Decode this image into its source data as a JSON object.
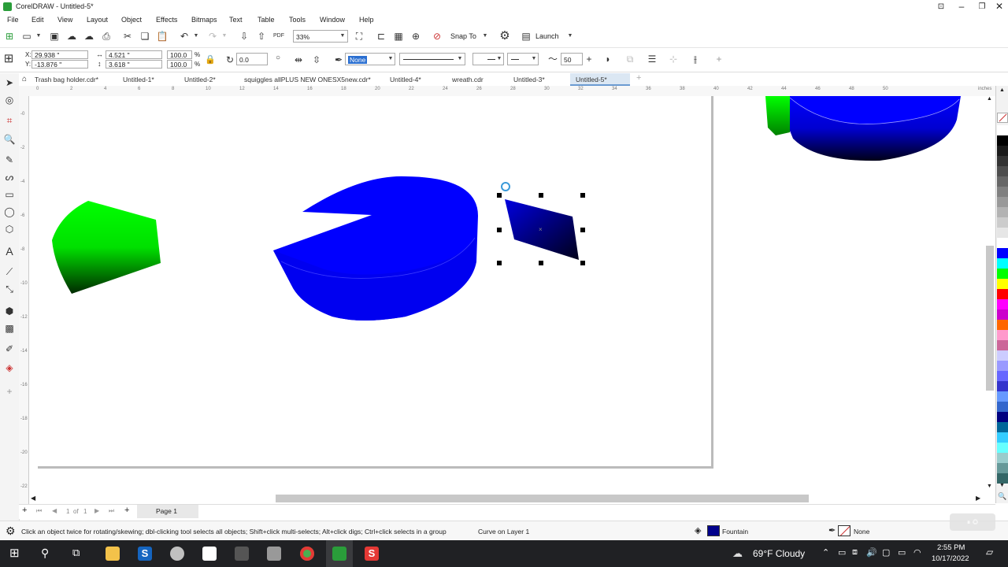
{
  "app": {
    "title": "CorelDRAW - Untitled-5*"
  },
  "menu": [
    "File",
    "Edit",
    "View",
    "Layout",
    "Object",
    "Effects",
    "Bitmaps",
    "Text",
    "Table",
    "Tools",
    "Window",
    "Help"
  ],
  "toolbar": {
    "zoom": "33%",
    "snap_to": "Snap To",
    "launch": "Launch"
  },
  "properties": {
    "x": "29.938 \"",
    "y": "-13.876 \"",
    "width": "4.521 \"",
    "height": "3.618 \"",
    "scale_w": "100.0",
    "scale_h": "100.0",
    "percent": "%",
    "rotation": "0.0",
    "outline_fill": "None",
    "outline_width_value": "50"
  },
  "tabs": [
    {
      "label": "Trash bag holder.cdr*"
    },
    {
      "label": "Untitled-1*"
    },
    {
      "label": "Untitled-2*"
    },
    {
      "label": "squiggles allPLUS NEW ONESX5new.cdr*"
    },
    {
      "label": "Untitled-4*"
    },
    {
      "label": "wreath.cdr"
    },
    {
      "label": "Untitled-3*"
    },
    {
      "label": "Untitled-5*"
    }
  ],
  "ruler": {
    "unit": "inches",
    "labels": [
      "0",
      "2",
      "4",
      "6",
      "8",
      "10",
      "12",
      "14",
      "16",
      "18",
      "20",
      "22",
      "24",
      "26",
      "28",
      "30",
      "32",
      "34",
      "36",
      "38",
      "40",
      "42",
      "44",
      "46",
      "48",
      "50"
    ]
  },
  "page_nav": {
    "page_current": "1",
    "of_label": "of",
    "page_total": "1",
    "page_tab": "Page 1"
  },
  "status": {
    "hint": "Click an object twice for rotating/skewing; dbl-clicking tool selects all objects; Shift+click multi-selects; Alt+click digs; Ctrl+click selects in a group",
    "object_info": "Curve on Layer 1",
    "fill_label": "Fountain",
    "outline_label": "None"
  },
  "taskbar": {
    "weather": "69°F  Cloudy",
    "time": "2:55 PM",
    "date": "10/17/2022"
  },
  "colors": {
    "blue": "#0000ff",
    "green": "#00ff00",
    "accent": "#6b9bd1"
  },
  "palette": [
    "#ffffff",
    "#000000",
    "#1a1a1a",
    "#333333",
    "#4d4d4d",
    "#666666",
    "#808080",
    "#999999",
    "#b3b3b3",
    "#cccccc",
    "#e6e6e6",
    "#ffffff",
    "#0000ff",
    "#00ffff",
    "#00ff00",
    "#ffff00",
    "#ff0000",
    "#ff00ff",
    "#cc00cc",
    "#ff6600",
    "#ff99cc",
    "#cc6699",
    "#ccccff",
    "#9999ff",
    "#6666ff",
    "#3333cc",
    "#6699ff",
    "#3366cc",
    "#000080",
    "#006699",
    "#33ccff",
    "#66ffff",
    "#99cccc",
    "#669999",
    "#336666"
  ]
}
